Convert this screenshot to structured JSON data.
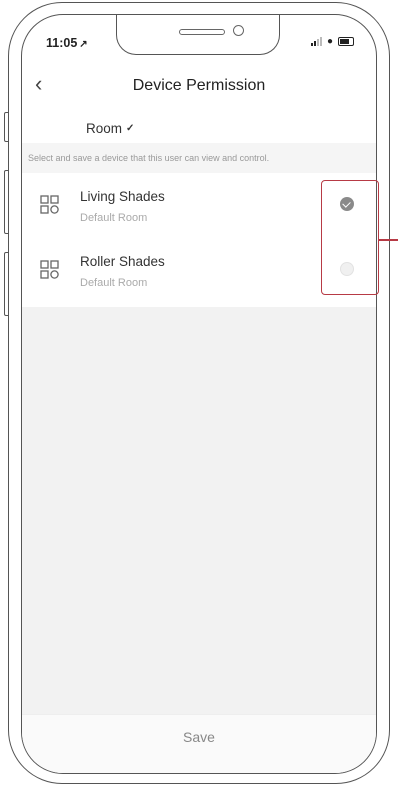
{
  "status": {
    "time": "11:05"
  },
  "header": {
    "title": "Device Permission",
    "back_icon": "chevron-left-icon"
  },
  "filter": {
    "room_label": "Room"
  },
  "hint": "Select and save a device that this user can view and control.",
  "devices": [
    {
      "name": "Living Shades",
      "room": "Default Room",
      "checked": true
    },
    {
      "name": "Roller Shades",
      "room": "Default Room",
      "checked": false
    }
  ],
  "footer": {
    "save_label": "Save"
  },
  "colors": {
    "highlight": "#b73a45",
    "checked": "#8a8a8a"
  }
}
